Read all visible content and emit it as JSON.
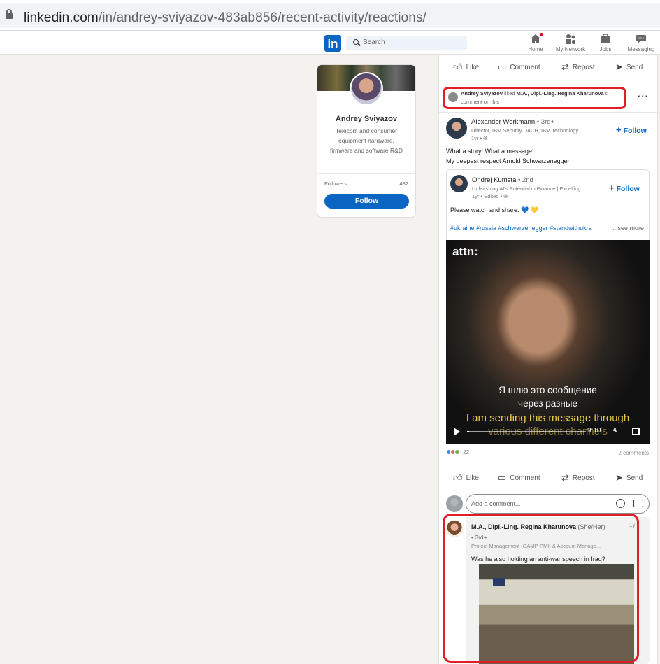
{
  "browser": {
    "url_domain": "linkedin.com",
    "url_path": "/in/andrey-sviyazov-483ab856/recent-activity/reactions/"
  },
  "nav": {
    "logo": "in",
    "search_placeholder": "Search",
    "items": [
      {
        "label": "Home",
        "icon": "home-icon"
      },
      {
        "label": "My Network",
        "icon": "network-icon"
      },
      {
        "label": "Jobs",
        "icon": "jobs-icon"
      },
      {
        "label": "Messaging",
        "icon": "messaging-icon"
      }
    ]
  },
  "profile": {
    "name": "Andrey Sviyazov",
    "headline": "Telecom and consumer equipment hardware, firmware and software R&D",
    "followers_label": "Followers",
    "followers_count": "482",
    "follow_label": "Follow"
  },
  "actions": {
    "like": "Like",
    "comment": "Comment",
    "repost": "Repost",
    "send": "Send"
  },
  "activity": {
    "actor": "Andrey Sviyazov",
    "verb": "liked",
    "target": "M.A., Dipl.-Ling. Regina Kharunova",
    "suffix1": "'s",
    "suffix2": "comment on this",
    "more": "···"
  },
  "post": {
    "author": "Alexander Werkmann",
    "degree": "• 3rd+",
    "headline": "Director, IBM Security DACH, IBM Technology",
    "time": "1yr •",
    "follow": "Follow",
    "text_line1": "What a story! What a message!",
    "text_line2": "My deepest respect Arnold Schwarzenegger"
  },
  "shared": {
    "author": "Ondrej Kumsta",
    "degree": "• 2nd",
    "headline": "Unleashing AI's Potential in Finance | Excelling ...",
    "time": "1yr • Edited •",
    "follow": "Follow",
    "text": "Please watch and share. 💙 💛",
    "hashtags": "#ukraine #russia #schwarzenegger #standwithukra",
    "see_more": "...see more"
  },
  "video": {
    "brand": "attn:",
    "subtitle_ru_1": "Я шлю это сообщение",
    "subtitle_ru_2": "через разные",
    "subtitle_en_1": "I am sending this message through",
    "subtitle_en_2": "various different channels",
    "time": "9:10",
    "progress": 0.02
  },
  "stats": {
    "reaction_count": "22",
    "comments": "2 comments"
  },
  "comment_input": {
    "placeholder": "Add a comment..."
  },
  "comment": {
    "author": "M.A., Dipl.-Ling. Regina Kharunova",
    "pronoun": "(She/Her)",
    "degree": "• 3rd+",
    "headline": "Project Management (CAMP-PMI) & Account Manage...",
    "time": "1y",
    "text": "Was he also holding an anti-war speech in Iraq?"
  },
  "colors": {
    "brand": "#0a66c2",
    "highlight": "#e01e25"
  }
}
